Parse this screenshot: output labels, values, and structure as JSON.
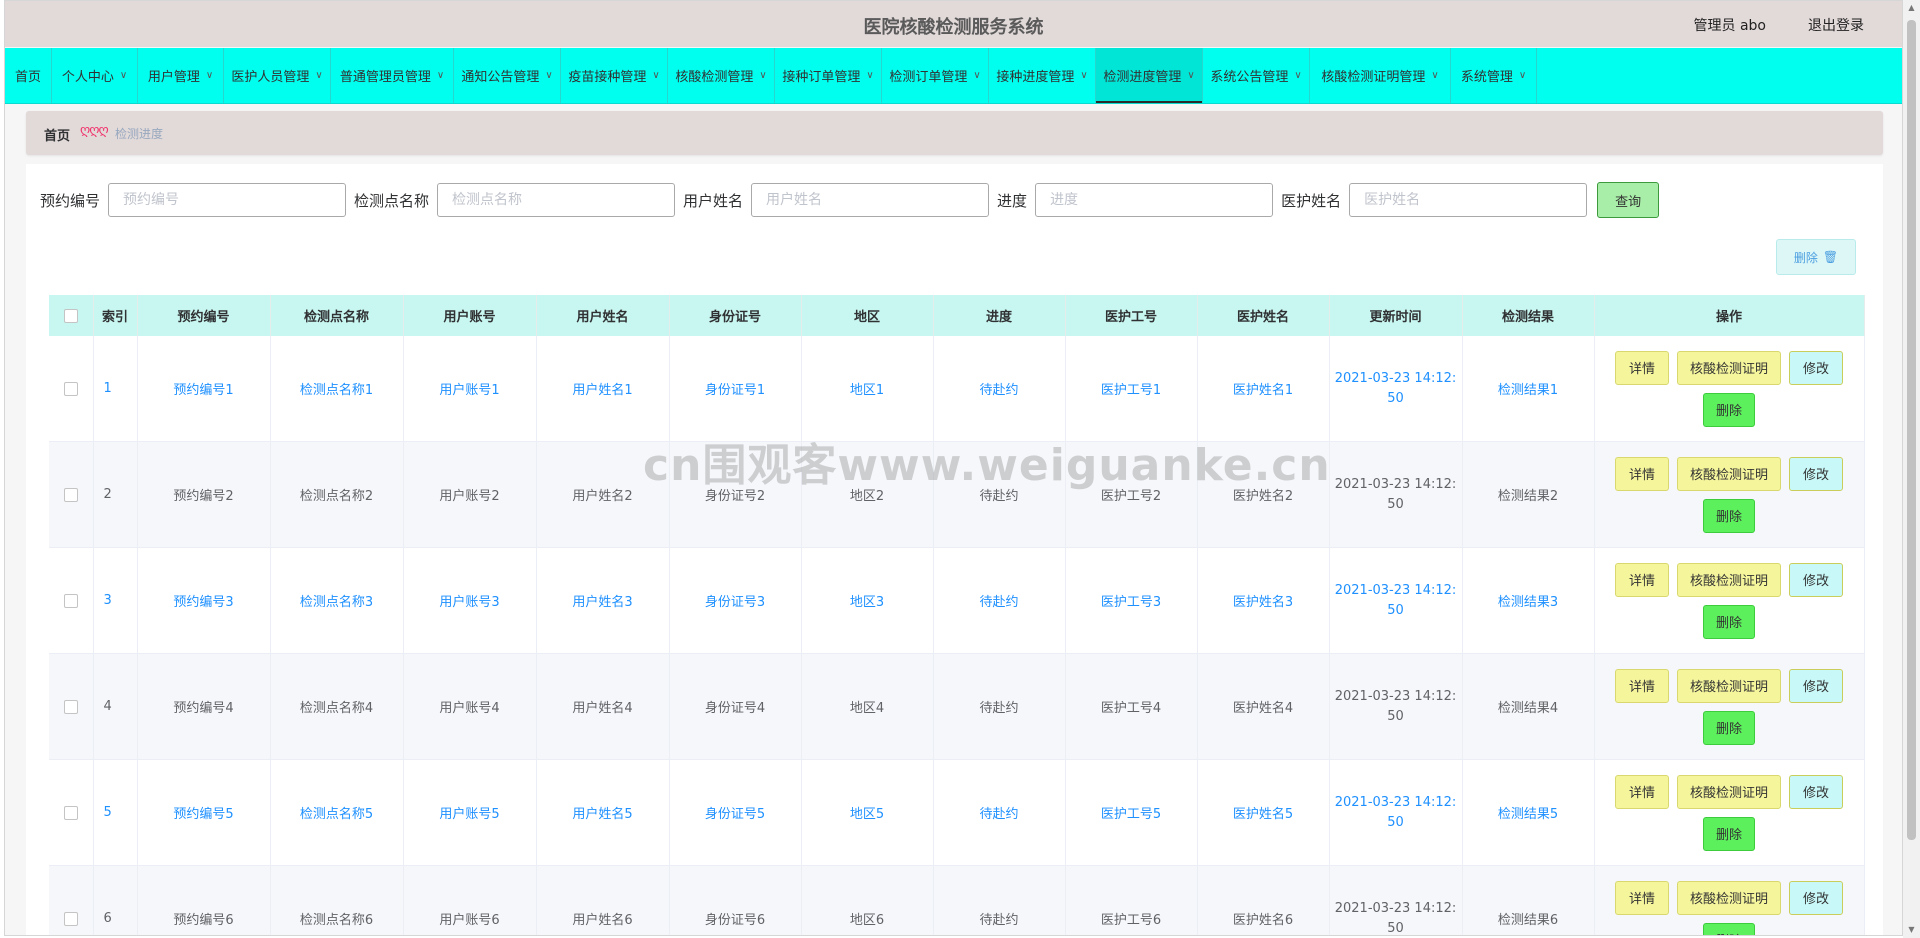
{
  "header": {
    "title": "医院核酸检测服务系统",
    "admin_label": "管理员 abo",
    "logout_label": "退出登录"
  },
  "nav": {
    "items": [
      {
        "label": "首页",
        "has_dropdown": false
      },
      {
        "label": "个人中心",
        "has_dropdown": true
      },
      {
        "label": "用户管理",
        "has_dropdown": true
      },
      {
        "label": "医护人员管理",
        "has_dropdown": true
      },
      {
        "label": "普通管理员管理",
        "has_dropdown": true
      },
      {
        "label": "通知公告管理",
        "has_dropdown": true
      },
      {
        "label": "疫苗接种管理",
        "has_dropdown": true
      },
      {
        "label": "核酸检测管理",
        "has_dropdown": true
      },
      {
        "label": "接种订单管理",
        "has_dropdown": true
      },
      {
        "label": "检测订单管理",
        "has_dropdown": true
      },
      {
        "label": "接种进度管理",
        "has_dropdown": true
      },
      {
        "label": "检测进度管理",
        "has_dropdown": true,
        "active": true
      },
      {
        "label": "系统公告管理",
        "has_dropdown": true
      },
      {
        "label": "核酸检测证明管理",
        "has_dropdown": true
      },
      {
        "label": "系统管理",
        "has_dropdown": true
      }
    ]
  },
  "breadcrumb": {
    "home": "首页",
    "separator": "ღღღ",
    "current": "检测进度"
  },
  "search": {
    "fields": [
      {
        "label": "预约编号",
        "placeholder": "预约编号",
        "value": ""
      },
      {
        "label": "检测点名称",
        "placeholder": "检测点名称",
        "value": ""
      },
      {
        "label": "用户姓名",
        "placeholder": "用户姓名",
        "value": ""
      },
      {
        "label": "进度",
        "placeholder": "进度",
        "value": ""
      },
      {
        "label": "医护姓名",
        "placeholder": "医护姓名",
        "value": ""
      }
    ],
    "query_label": "查询"
  },
  "toolbar": {
    "delete_label": "删除",
    "delete_icon": "trash-icon"
  },
  "table": {
    "columns": [
      "",
      "索引",
      "预约编号",
      "检测点名称",
      "用户账号",
      "用户姓名",
      "身份证号",
      "地区",
      "进度",
      "医护工号",
      "医护姓名",
      "更新时间",
      "检测结果",
      "操作"
    ],
    "rows": [
      {
        "index": "1",
        "appt": "预约编号1",
        "site": "检测点名称1",
        "account": "用户账号1",
        "name": "用户姓名1",
        "idcard": "身份证号1",
        "region": "地区1",
        "progress": "待赴约",
        "staff_no": "医护工号1",
        "staff_name": "医护姓名1",
        "time_a": "2021-03-23 14:12:",
        "time_b": "50",
        "result": "检测结果1"
      },
      {
        "index": "2",
        "appt": "预约编号2",
        "site": "检测点名称2",
        "account": "用户账号2",
        "name": "用户姓名2",
        "idcard": "身份证号2",
        "region": "地区2",
        "progress": "待赴约",
        "staff_no": "医护工号2",
        "staff_name": "医护姓名2",
        "time_a": "2021-03-23 14:12:",
        "time_b": "50",
        "result": "检测结果2"
      },
      {
        "index": "3",
        "appt": "预约编号3",
        "site": "检测点名称3",
        "account": "用户账号3",
        "name": "用户姓名3",
        "idcard": "身份证号3",
        "region": "地区3",
        "progress": "待赴约",
        "staff_no": "医护工号3",
        "staff_name": "医护姓名3",
        "time_a": "2021-03-23 14:12:",
        "time_b": "50",
        "result": "检测结果3"
      },
      {
        "index": "4",
        "appt": "预约编号4",
        "site": "检测点名称4",
        "account": "用户账号4",
        "name": "用户姓名4",
        "idcard": "身份证号4",
        "region": "地区4",
        "progress": "待赴约",
        "staff_no": "医护工号4",
        "staff_name": "医护姓名4",
        "time_a": "2021-03-23 14:12:",
        "time_b": "50",
        "result": "检测结果4"
      },
      {
        "index": "5",
        "appt": "预约编号5",
        "site": "检测点名称5",
        "account": "用户账号5",
        "name": "用户姓名5",
        "idcard": "身份证号5",
        "region": "地区5",
        "progress": "待赴约",
        "staff_no": "医护工号5",
        "staff_name": "医护姓名5",
        "time_a": "2021-03-23 14:12:",
        "time_b": "50",
        "result": "检测结果5"
      },
      {
        "index": "6",
        "appt": "预约编号6",
        "site": "检测点名称6",
        "account": "用户账号6",
        "name": "用户姓名6",
        "idcard": "身份证号6",
        "region": "地区6",
        "progress": "待赴约",
        "staff_no": "医护工号6",
        "staff_name": "医护姓名6",
        "time_a": "2021-03-23 14:12:",
        "time_b": "50",
        "result": "检测结果6"
      }
    ],
    "actions": {
      "detail": "详情",
      "certificate": "核酸检测证明",
      "edit": "修改",
      "delete": "删除"
    }
  },
  "watermark": "cn围观客www.weiguanke.cn",
  "colors": {
    "nav_bg": "#00ffee",
    "header_bg": "#e2d9d9",
    "table_header_bg": "#c8f6f0",
    "link_blue": "#1e90ff",
    "btn_yellow": "#f5f59c",
    "btn_green": "#5cf05c"
  }
}
